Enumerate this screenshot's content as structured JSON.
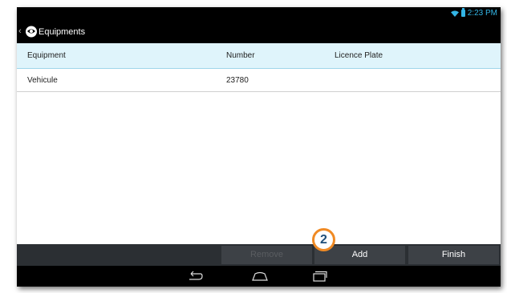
{
  "statusbar": {
    "time": "2:23 PM"
  },
  "actionbar": {
    "title": "Equipments"
  },
  "table": {
    "columns": [
      "Equipment",
      "Number",
      "Licence Plate"
    ],
    "rows": [
      {
        "equipment": "Vehicule",
        "number": "23780",
        "licence_plate": ""
      }
    ]
  },
  "buttons": {
    "remove": "Remove",
    "add": "Add",
    "finish": "Finish"
  },
  "annotation": {
    "step": "2"
  },
  "colors": {
    "accent": "#33b5e5",
    "header_bg": "#dff4fb",
    "callout_border": "#f08a24"
  }
}
